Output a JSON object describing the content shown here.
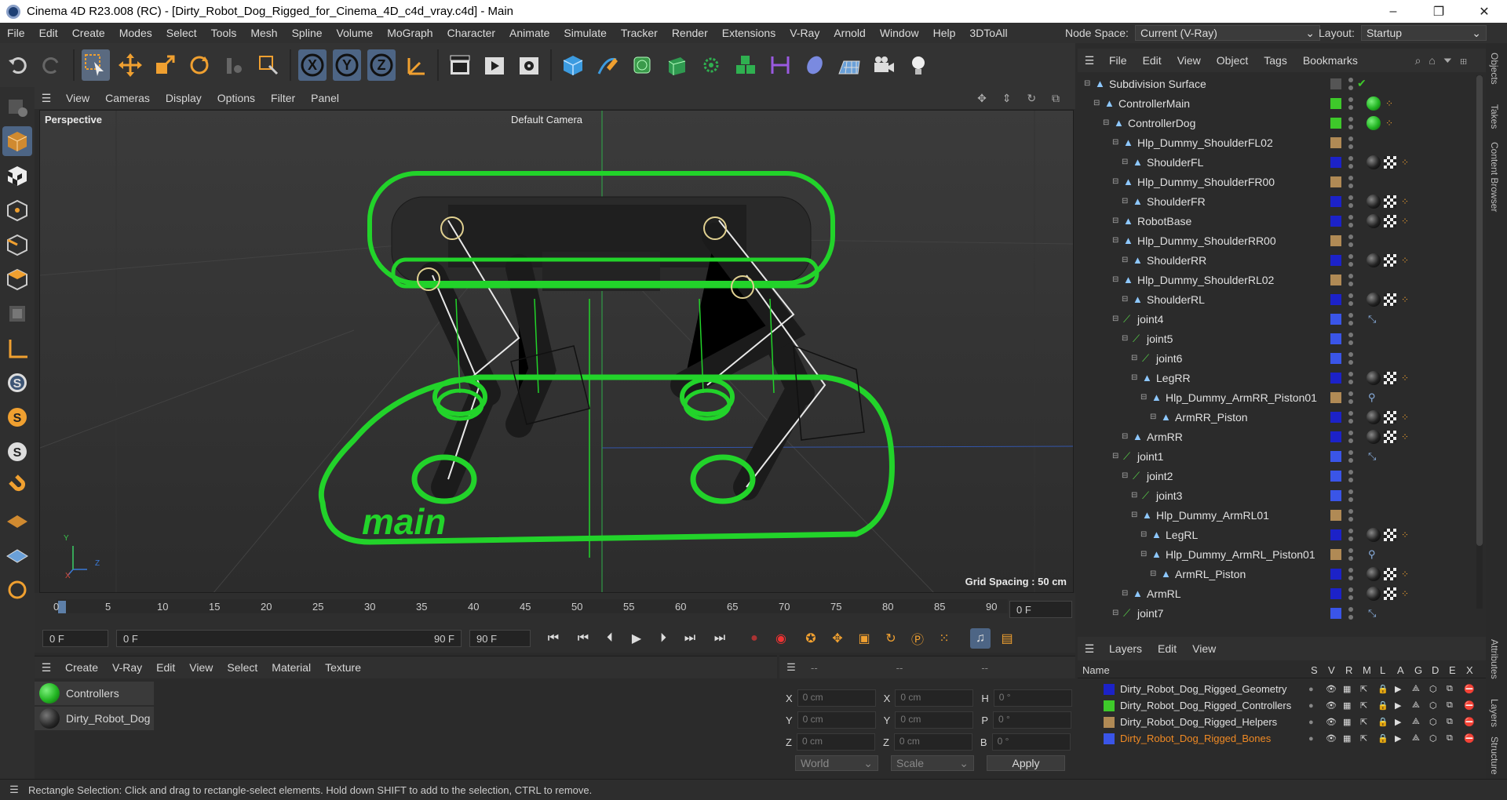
{
  "window": {
    "title": "Cinema 4D R23.008 (RC) - [Dirty_Robot_Dog_Rigged_for_Cinema_4D_c4d_vray.c4d] - Main",
    "minimize": "–",
    "maximize": "❐",
    "close": "✕"
  },
  "menu": [
    "File",
    "Edit",
    "Create",
    "Modes",
    "Select",
    "Tools",
    "Mesh",
    "Spline",
    "Volume",
    "MoGraph",
    "Character",
    "Animate",
    "Simulate",
    "Tracker",
    "Render",
    "Extensions",
    "V-Ray",
    "Arnold",
    "Window",
    "Help",
    "3DToAll"
  ],
  "node_space": {
    "label": "Node Space:",
    "value": "Current (V-Ray)"
  },
  "layout": {
    "label": "Layout:",
    "value": "Startup"
  },
  "toolbar_axes": [
    "X",
    "Y",
    "Z"
  ],
  "viewport_menu": [
    "View",
    "Cameras",
    "Display",
    "Options",
    "Filter",
    "Panel"
  ],
  "viewport": {
    "name": "Perspective",
    "camera": "Default Camera",
    "grid_spacing": "Grid Spacing : 50 cm",
    "logo_text": "main"
  },
  "timeline": {
    "ticks": [
      "0",
      "5",
      "10",
      "15",
      "20",
      "25",
      "30",
      "35",
      "40",
      "45",
      "50",
      "55",
      "60",
      "65",
      "70",
      "75",
      "80",
      "85",
      "90"
    ],
    "frame_field": "0 F"
  },
  "transport": {
    "start": "0 F",
    "current": "0 F",
    "end_inner": "90 F",
    "end": "90 F"
  },
  "materials": {
    "menu": [
      "Create",
      "V-Ray",
      "Edit",
      "View",
      "Select",
      "Material",
      "Texture"
    ],
    "items": [
      {
        "name": "Controllers",
        "color": "#22b522"
      },
      {
        "name": "Dirty_Robot_Dog",
        "color": "#2a2a2a"
      }
    ]
  },
  "coords": {
    "header": [
      "--",
      "--",
      "--"
    ],
    "rows": [
      {
        "a": "X",
        "av": "0 cm",
        "b": "X",
        "bv": "0 cm",
        "c": "H",
        "cv": "0 °"
      },
      {
        "a": "Y",
        "av": "0 cm",
        "b": "Y",
        "bv": "0 cm",
        "c": "P",
        "cv": "0 °"
      },
      {
        "a": "Z",
        "av": "0 cm",
        "b": "Z",
        "bv": "0 cm",
        "c": "B",
        "cv": "0 °"
      }
    ],
    "world": "World",
    "scale": "Scale",
    "apply": "Apply"
  },
  "status": "Rectangle Selection: Click and drag to rectangle-select elements. Hold down SHIFT to add to the selection, CTRL to remove.",
  "objects": {
    "menu": [
      "File",
      "Edit",
      "View",
      "Object",
      "Tags",
      "Bookmarks"
    ],
    "rows": [
      {
        "name": "Subdivision Surface",
        "indent": 0,
        "color": "#555555",
        "tags": "check"
      },
      {
        "name": "ControllerMain",
        "indent": 1,
        "color": "#3ec92a",
        "tags": "green"
      },
      {
        "name": "ControllerDog",
        "indent": 2,
        "color": "#3ec92a",
        "tags": "green"
      },
      {
        "name": "Hlp_Dummy_ShoulderFL02",
        "indent": 3,
        "color": "#b08a55",
        "tags": ""
      },
      {
        "name": "ShoulderFL",
        "indent": 4,
        "color": "#1c22c8",
        "tags": "mat"
      },
      {
        "name": "Hlp_Dummy_ShoulderFR00",
        "indent": 3,
        "color": "#b08a55",
        "tags": ""
      },
      {
        "name": "ShoulderFR",
        "indent": 4,
        "color": "#1c22c8",
        "tags": "mat"
      },
      {
        "name": "RobotBase",
        "indent": 3,
        "color": "#1c22c8",
        "tags": "mat"
      },
      {
        "name": "Hlp_Dummy_ShoulderRR00",
        "indent": 3,
        "color": "#b08a55",
        "tags": ""
      },
      {
        "name": "ShoulderRR",
        "indent": 4,
        "color": "#1c22c8",
        "tags": "mat"
      },
      {
        "name": "Hlp_Dummy_ShoulderRL02",
        "indent": 3,
        "color": "#b08a55",
        "tags": ""
      },
      {
        "name": "ShoulderRL",
        "indent": 4,
        "color": "#1c22c8",
        "tags": "mat"
      },
      {
        "name": "joint4",
        "indent": 3,
        "color": "#3a55e8",
        "tags": "ik"
      },
      {
        "name": "joint5",
        "indent": 4,
        "color": "#3a55e8",
        "tags": ""
      },
      {
        "name": "joint6",
        "indent": 5,
        "color": "#3a55e8",
        "tags": ""
      },
      {
        "name": "LegRR",
        "indent": 5,
        "color": "#1c22c8",
        "tags": "mat"
      },
      {
        "name": "Hlp_Dummy_ArmRR_Piston01",
        "indent": 6,
        "color": "#b08a55",
        "tags": "ik2"
      },
      {
        "name": "ArmRR_Piston",
        "indent": 7,
        "color": "#1c22c8",
        "tags": "mat"
      },
      {
        "name": "ArmRR",
        "indent": 4,
        "color": "#1c22c8",
        "tags": "mat"
      },
      {
        "name": "joint1",
        "indent": 3,
        "color": "#3a55e8",
        "tags": "ik"
      },
      {
        "name": "joint2",
        "indent": 4,
        "color": "#3a55e8",
        "tags": ""
      },
      {
        "name": "joint3",
        "indent": 5,
        "color": "#3a55e8",
        "tags": ""
      },
      {
        "name": "Hlp_Dummy_ArmRL01",
        "indent": 5,
        "color": "#b08a55",
        "tags": ""
      },
      {
        "name": "LegRL",
        "indent": 6,
        "color": "#1c22c8",
        "tags": "mat"
      },
      {
        "name": "Hlp_Dummy_ArmRL_Piston01",
        "indent": 6,
        "color": "#b08a55",
        "tags": "ik2"
      },
      {
        "name": "ArmRL_Piston",
        "indent": 7,
        "color": "#1c22c8",
        "tags": "mat"
      },
      {
        "name": "ArmRL",
        "indent": 4,
        "color": "#1c22c8",
        "tags": "mat"
      },
      {
        "name": "joint7",
        "indent": 3,
        "color": "#3a55e8",
        "tags": "ik"
      }
    ]
  },
  "layers": {
    "menu": [
      "Layers",
      "Edit",
      "View"
    ],
    "header": {
      "name": "Name",
      "cols": [
        "S",
        "V",
        "R",
        "M",
        "L",
        "A",
        "G",
        "D",
        "E",
        "X"
      ]
    },
    "items": [
      {
        "name": "Dirty_Robot_Dog_Rigged_Geometry",
        "color": "#1c22c8",
        "text_color": "#e0e0e0"
      },
      {
        "name": "Dirty_Robot_Dog_Rigged_Controllers",
        "color": "#3ec92a",
        "text_color": "#e0e0e0"
      },
      {
        "name": "Dirty_Robot_Dog_Rigged_Helpers",
        "color": "#b08a55",
        "text_color": "#e0e0e0"
      },
      {
        "name": "Dirty_Robot_Dog_Rigged_Bones",
        "color": "#3a55e8",
        "text_color": "#f08a24"
      }
    ]
  },
  "side_tabs": [
    "Objects",
    "Takes",
    "Content Browser",
    "Attributes",
    "Layers",
    "Structure"
  ]
}
